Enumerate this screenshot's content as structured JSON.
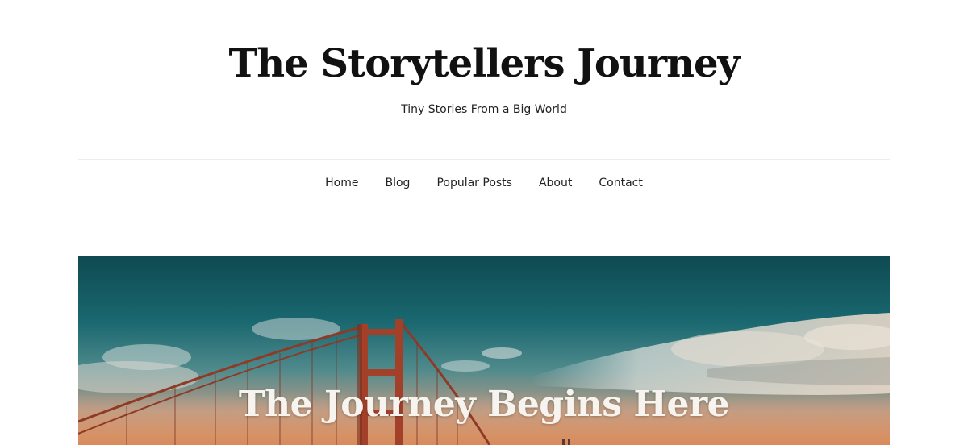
{
  "header": {
    "site_title": "The Storytellers Journey",
    "tagline": "Tiny Stories From a Big World"
  },
  "nav": {
    "items": [
      {
        "label": "Home"
      },
      {
        "label": "Blog"
      },
      {
        "label": "Popular Posts"
      },
      {
        "label": "About"
      },
      {
        "label": "Contact"
      }
    ]
  },
  "hero": {
    "title": "The Journey Begins Here",
    "image_subject": "golden-gate-bridge-at-sunset"
  },
  "colors": {
    "text": "#111111",
    "divider": "#ececec",
    "sky_top": "#0f4d55",
    "sky_mid": "#1f6d73",
    "sunset": "#c98d6a",
    "bridge": "#a3402a",
    "hero_title": "#f7f3ef"
  }
}
